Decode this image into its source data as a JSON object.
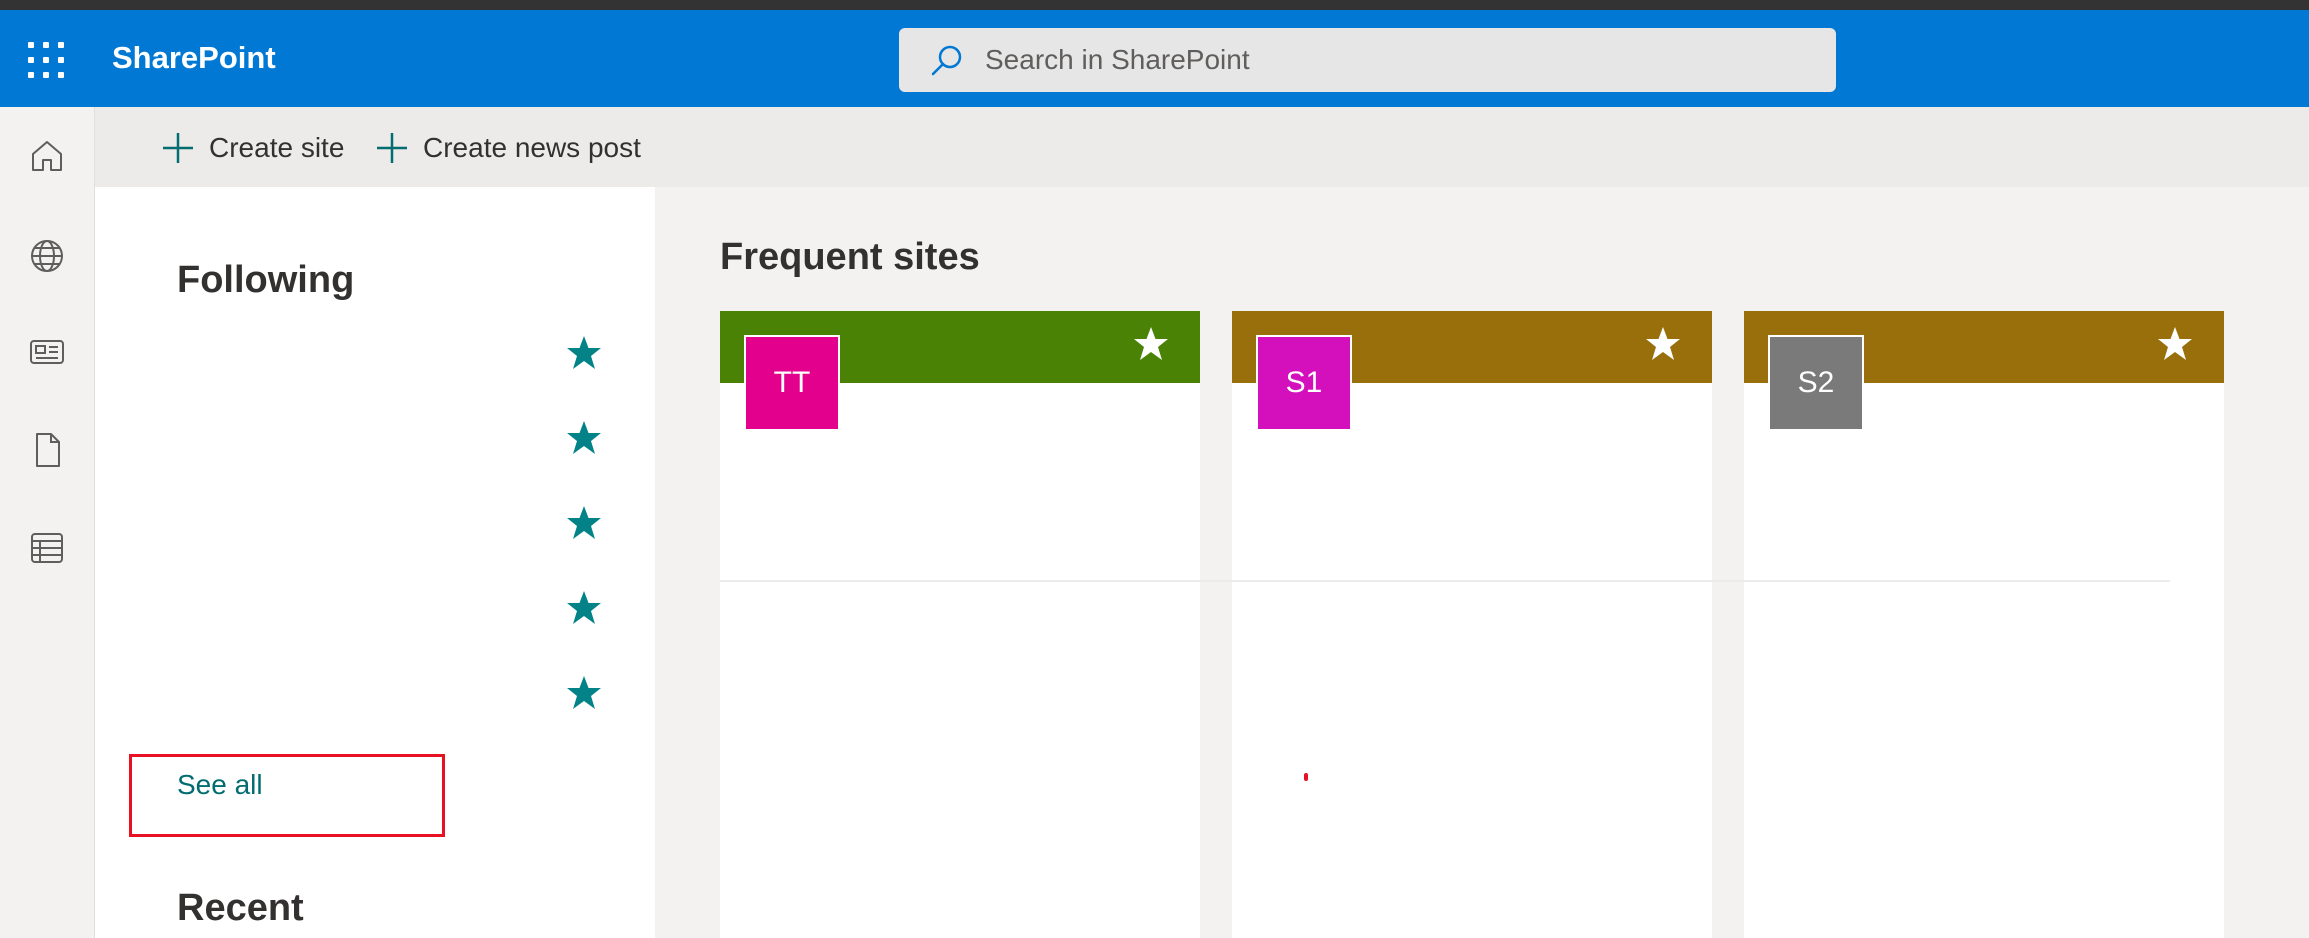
{
  "app": {
    "title": "SharePoint"
  },
  "search": {
    "placeholder": "Search in SharePoint"
  },
  "rail": {
    "items": [
      {
        "name": "home",
        "icon": "home-icon"
      },
      {
        "name": "sites",
        "icon": "globe-icon"
      },
      {
        "name": "news",
        "icon": "news-icon"
      },
      {
        "name": "files",
        "icon": "document-icon"
      },
      {
        "name": "lists",
        "icon": "list-icon"
      }
    ]
  },
  "commands": {
    "create_site": "Create site",
    "create_news_post": "Create news post"
  },
  "following": {
    "title": "Following",
    "items_count_visible": 5,
    "see_all": "See all"
  },
  "recent": {
    "title": "Recent"
  },
  "frequent": {
    "title": "Frequent sites",
    "cards": [
      {
        "initials": "TT",
        "header_color": "#498205",
        "logo_color": "#e3008c"
      },
      {
        "initials": "S1",
        "header_color": "#986f0b",
        "logo_color": "#d40fbc"
      },
      {
        "initials": "S2",
        "header_color": "#986f0b",
        "logo_color": "#7a7a7a"
      }
    ]
  },
  "colors": {
    "suite_bar": "#0078d4",
    "accent_teal": "#036c70",
    "highlight_box": "#e81123"
  }
}
